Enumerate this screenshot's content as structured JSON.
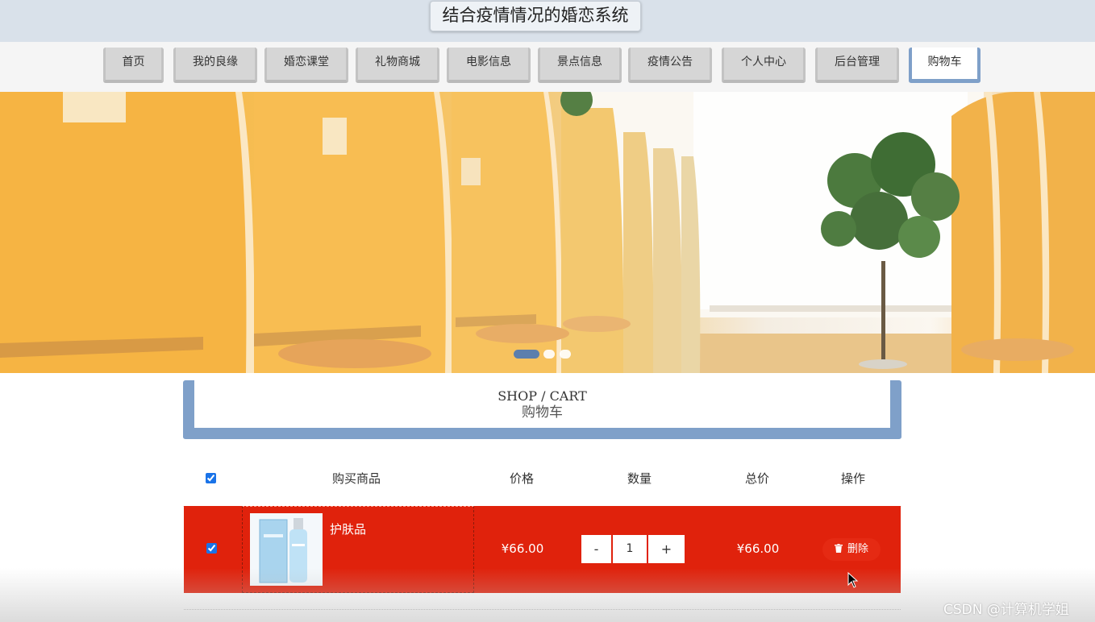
{
  "header": {
    "title": "结合疫情情况的婚恋系统"
  },
  "nav": {
    "items": [
      {
        "label": "首页"
      },
      {
        "label": "我的良缘"
      },
      {
        "label": "婚恋课堂"
      },
      {
        "label": "礼物商城"
      },
      {
        "label": "电影信息"
      },
      {
        "label": "景点信息"
      },
      {
        "label": "疫情公告"
      },
      {
        "label": "个人中心"
      },
      {
        "label": "后台管理"
      },
      {
        "label": "购物车"
      }
    ],
    "active_index": 9
  },
  "carousel": {
    "slide_count": 3,
    "active_slide": 1
  },
  "section": {
    "title_en": "SHOP / CART",
    "title_cn": "购物车"
  },
  "cart": {
    "columns": {
      "product": "购买商品",
      "price": "价格",
      "quantity": "数量",
      "total": "总价",
      "action": "操作"
    },
    "select_all_checked": true,
    "items": [
      {
        "checked": true,
        "name": "护肤品",
        "price": "¥66.00",
        "quantity": "1",
        "total": "¥66.00",
        "minus_label": "-",
        "plus_label": "+",
        "delete_label": "删除"
      }
    ]
  },
  "watermark": "CSDN @计算机学姐",
  "colors": {
    "accent": "#7fa0c9",
    "row_highlight": "#e0220c",
    "active_dot": "#4a78b6"
  }
}
